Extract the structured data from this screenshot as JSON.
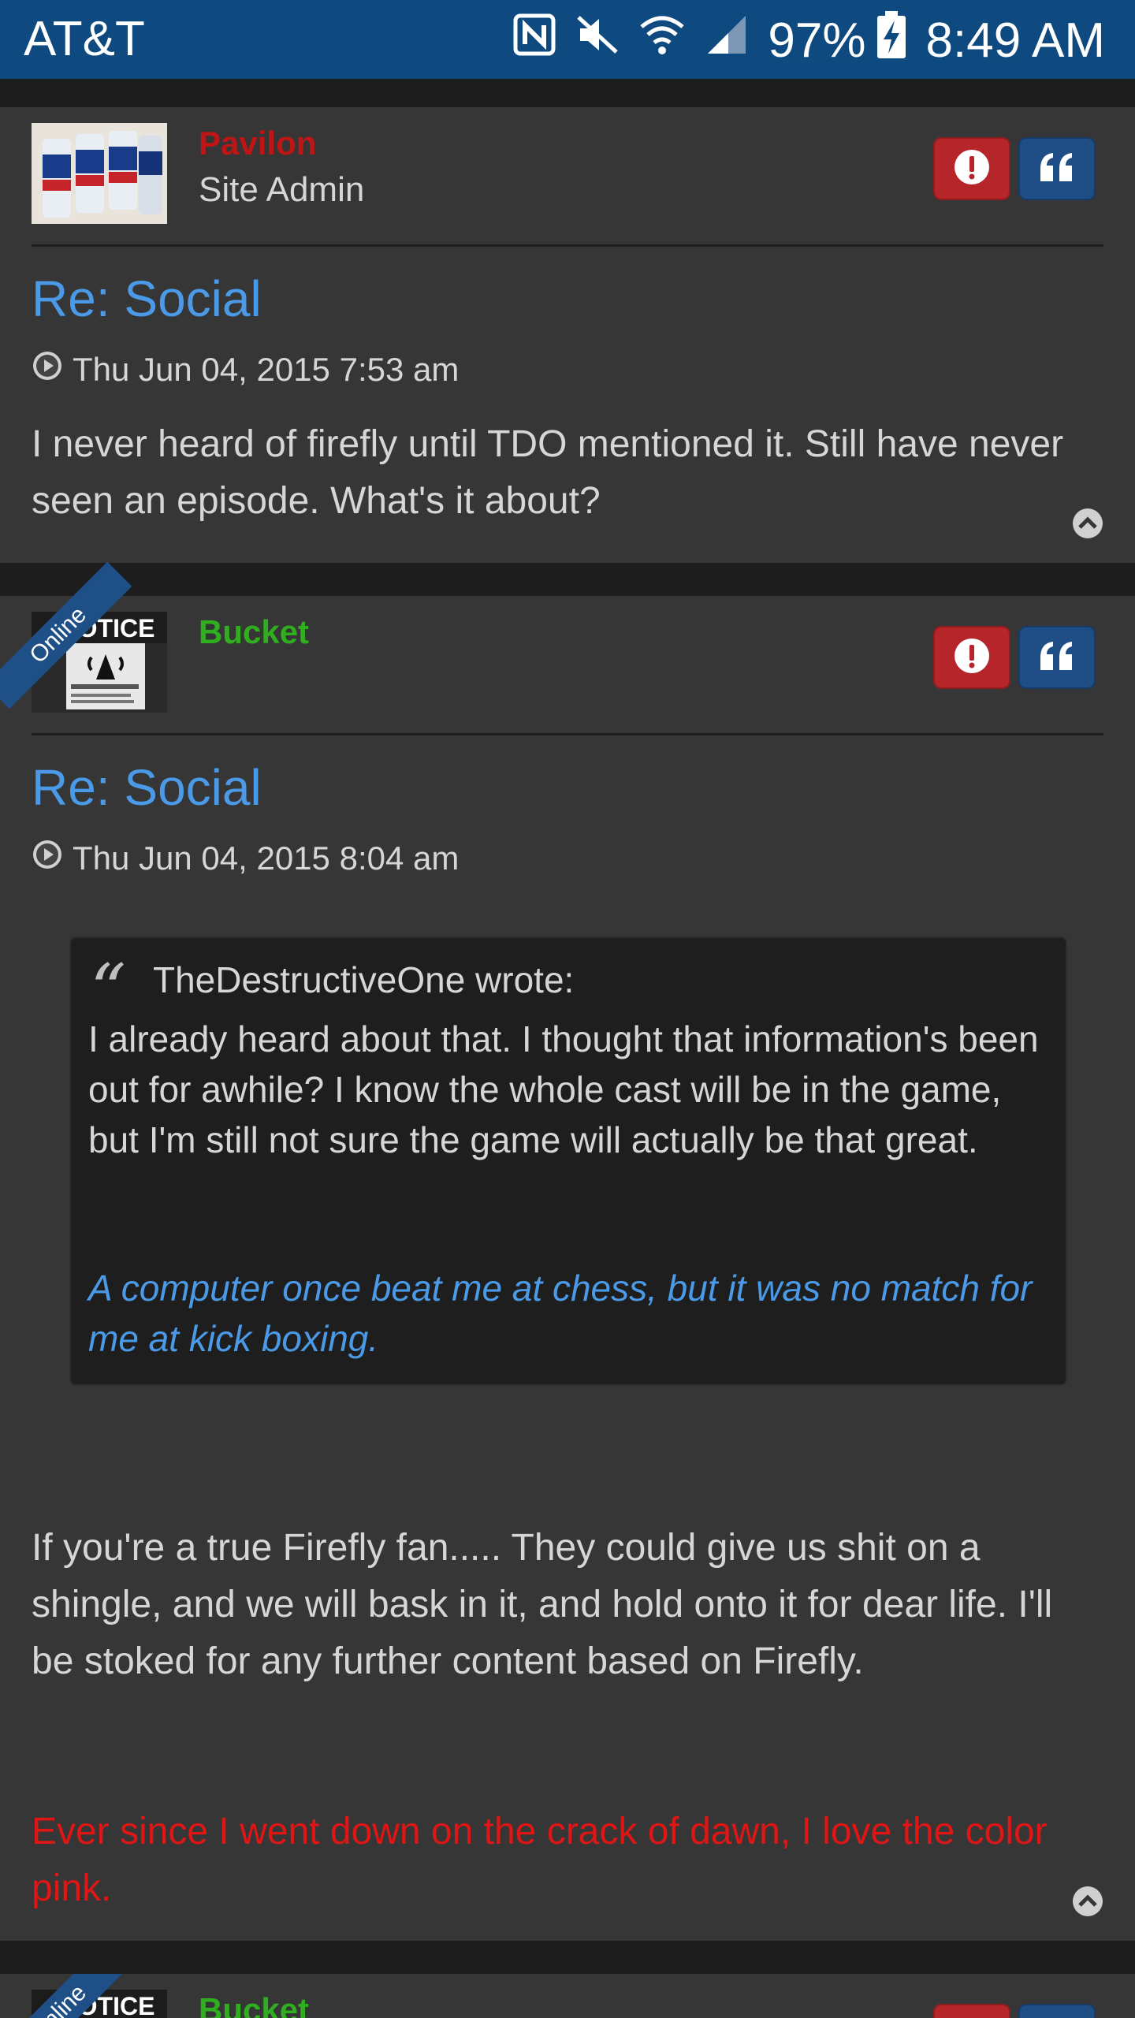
{
  "status_bar": {
    "carrier": "AT&T",
    "battery": "97%",
    "time": "8:49 AM"
  },
  "posts": [
    {
      "username": "Pavilon",
      "username_color": "#c01515",
      "rank": "Site Admin",
      "title": "Re: Social",
      "date": "Thu Jun 04, 2015 7:53 am",
      "body": "I never heard of firefly until TDO mentioned it. Still have never seen an episode. What's it about?"
    },
    {
      "username": "Bucket",
      "username_color": "#2fae1f",
      "online": "Online",
      "avatar_text": "NOTICE",
      "title": "Re: Social",
      "date": "Thu Jun 04, 2015 8:04 am",
      "quote": {
        "author": "TheDestructiveOne wrote:",
        "text": "I already heard about that. I thought that information's been out for awhile? I know the whole cast will be in the game, but I'm still not sure the game will actually be that great.",
        "signature": "A computer once beat me at chess, but it was no match for me at kick boxing."
      },
      "body": "If you're a true Firefly fan..... They could give us shit on a shingle, and we will bask in it, and hold onto it for dear life. I'll be stoked for any further content based on Firefly.",
      "signature": "Ever since I went down on the crack of dawn, I love the color pink.",
      "signature_color": "#e01515"
    },
    {
      "username": "Bucket",
      "online": "Online",
      "avatar_text": "NOTICE"
    }
  ]
}
